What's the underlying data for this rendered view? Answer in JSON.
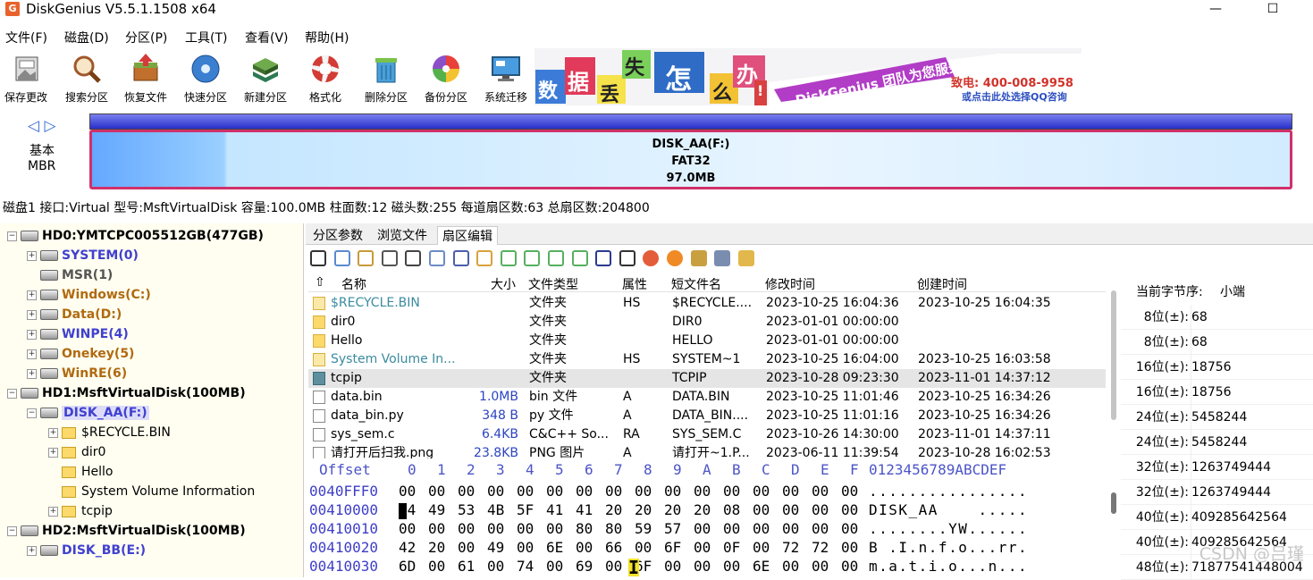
{
  "title": "DiskGenius V5.5.1.1508 x64",
  "app_icon_letter": "G",
  "window_controls": {
    "minimize": "—",
    "maximize": "☐"
  },
  "menu": [
    "文件(F)",
    "磁盘(D)",
    "分区(P)",
    "工具(T)",
    "查看(V)",
    "帮助(H)"
  ],
  "toolbar": [
    {
      "label": "保存更改",
      "icon": "save-icon"
    },
    {
      "label": "搜索分区",
      "icon": "magnifier-icon"
    },
    {
      "label": "恢复文件",
      "icon": "recover-icon"
    },
    {
      "label": "快速分区",
      "icon": "disc-icon"
    },
    {
      "label": "新建分区",
      "icon": "stack-icon"
    },
    {
      "label": "格式化",
      "icon": "lifebuoy-icon"
    },
    {
      "label": "删除分区",
      "icon": "trash-icon"
    },
    {
      "label": "备份分区",
      "icon": "pie-icon"
    },
    {
      "label": "系统迁移",
      "icon": "monitor-icon"
    }
  ],
  "banner": {
    "chars": [
      "数",
      "据",
      "丢",
      "失",
      "怎",
      "么",
      "办",
      "!"
    ],
    "slogan": "DiskGenius 团队为您服务",
    "phone": "致电: 400-008-9958",
    "qq": "或点击此处选择QQ咨询"
  },
  "disk_map": {
    "arrows": "◁ ▷",
    "type_label": "基本",
    "scheme": "MBR",
    "partition_name": "DISK_AA(F:)",
    "partition_fs": "FAT32",
    "partition_size": "97.0MB"
  },
  "disk_info": "磁盘1 接口:Virtual  型号:MsftVirtualDisk  容量:100.0MB  柱面数:12  磁头数:255  每道扇区数:63  总扇区数:204800",
  "tree": [
    {
      "label": "HD0:YMTCPC005512GB(477GB)",
      "level": 0,
      "kind": "disk",
      "color": "black",
      "exp": "−"
    },
    {
      "label": "SYSTEM(0)",
      "level": 1,
      "kind": "part",
      "color": "blue",
      "exp": "+"
    },
    {
      "label": "MSR(1)",
      "level": 1,
      "kind": "part",
      "color": "gray",
      "exp": ""
    },
    {
      "label": "Windows(C:)",
      "level": 1,
      "kind": "part",
      "color": "brown",
      "exp": "+"
    },
    {
      "label": "Data(D:)",
      "level": 1,
      "kind": "part",
      "color": "brown",
      "exp": "+"
    },
    {
      "label": "WINPE(4)",
      "level": 1,
      "kind": "part",
      "color": "blue",
      "exp": "+"
    },
    {
      "label": "Onekey(5)",
      "level": 1,
      "kind": "part",
      "color": "brown",
      "exp": "+"
    },
    {
      "label": "WinRE(6)",
      "level": 1,
      "kind": "part",
      "color": "brown",
      "exp": "+"
    },
    {
      "label": "HD1:MsftVirtualDisk(100MB)",
      "level": 0,
      "kind": "disk",
      "color": "black",
      "exp": "−"
    },
    {
      "label": "DISK_AA(F:)",
      "level": 1,
      "kind": "part",
      "color": "blue",
      "exp": "−",
      "selected": true
    },
    {
      "label": "$RECYCLE.BIN",
      "level": 2,
      "kind": "folder",
      "color": "normal",
      "exp": "+"
    },
    {
      "label": "dir0",
      "level": 2,
      "kind": "folder",
      "color": "normal",
      "exp": "+"
    },
    {
      "label": "Hello",
      "level": 2,
      "kind": "folder",
      "color": "normal",
      "exp": ""
    },
    {
      "label": "System Volume Information",
      "level": 2,
      "kind": "folder",
      "color": "normal",
      "exp": ""
    },
    {
      "label": "tcpip",
      "level": 2,
      "kind": "folder",
      "color": "normal",
      "exp": "+"
    },
    {
      "label": "HD2:MsftVirtualDisk(100MB)",
      "level": 0,
      "kind": "disk",
      "color": "black",
      "exp": "−"
    },
    {
      "label": "DISK_BB(E:)",
      "level": 1,
      "kind": "part",
      "color": "blue",
      "exp": "+"
    }
  ],
  "tabs": [
    "分区参数",
    "浏览文件",
    "扇区编辑"
  ],
  "active_tab": 2,
  "file_table": {
    "up_arrow": "⇧",
    "columns": [
      "名称",
      "大小",
      "文件类型",
      "属性",
      "短文件名",
      "修改时间",
      "创建时间"
    ],
    "rows": [
      {
        "name": "$RECYCLE.BIN",
        "size": "",
        "type": "文件夹",
        "attr": "HS",
        "short": "$RECYCLE....",
        "mtime": "2023-10-25 16:04:36",
        "ctime": "2023-10-25 16:04:35",
        "icon": "folder-icon",
        "hidden": true
      },
      {
        "name": "dir0",
        "size": "",
        "type": "文件夹",
        "attr": "",
        "short": "DIR0",
        "mtime": "2023-01-01 00:00:00",
        "ctime": "",
        "icon": "folder-icon"
      },
      {
        "name": "Hello",
        "size": "",
        "type": "文件夹",
        "attr": "",
        "short": "HELLO",
        "mtime": "2023-01-01 00:00:00",
        "ctime": "",
        "icon": "folder-icon"
      },
      {
        "name": "System Volume In...",
        "size": "",
        "type": "文件夹",
        "attr": "HS",
        "short": "SYSTEM~1",
        "mtime": "2023-10-25 16:04:00",
        "ctime": "2023-10-25 16:03:58",
        "icon": "folder-icon",
        "hidden": true
      },
      {
        "name": "tcpip",
        "size": "",
        "type": "文件夹",
        "attr": "",
        "short": "TCPIP",
        "mtime": "2023-10-28 09:23:30",
        "ctime": "2023-11-01 14:37:12",
        "icon": "folder-icon",
        "selected": true
      },
      {
        "name": "data.bin",
        "size": "1.0MB",
        "type": "bin 文件",
        "attr": "A",
        "short": "DATA.BIN",
        "mtime": "2023-10-25 11:01:46",
        "ctime": "2023-10-25 16:34:26",
        "icon": "file-icon"
      },
      {
        "name": "data_bin.py",
        "size": "348 B",
        "type": "py 文件",
        "attr": "A",
        "short": "DATA_BIN....",
        "mtime": "2023-10-25 11:01:16",
        "ctime": "2023-10-25 16:34:26",
        "icon": "file-icon"
      },
      {
        "name": "sys_sem.c",
        "size": "6.4KB",
        "type": "C&C++ So...",
        "attr": "RA",
        "short": "SYS_SEM.C",
        "mtime": "2023-10-26 14:30:00",
        "ctime": "2023-11-01 14:37:11",
        "icon": "c-file-icon"
      },
      {
        "name": "请打开后扫我.png",
        "size": "23.8KB",
        "type": "PNG 图片",
        "attr": "A",
        "short": "请打开~1.P...",
        "mtime": "2023-06-11 11:39:54",
        "ctime": "2023-10-28 16:02:53",
        "icon": "image-file-icon"
      }
    ]
  },
  "hex": {
    "header_offset": "Offset",
    "header_cols": [
      "0",
      "1",
      "2",
      "3",
      "4",
      "5",
      "6",
      "7",
      "8",
      "9",
      "A",
      "B",
      "C",
      "D",
      "E",
      "F"
    ],
    "header_ascii": "0123456789ABCDEF",
    "rows": [
      {
        "offset": "0040FFF0",
        "bytes": [
          "00",
          "00",
          "00",
          "00",
          "00",
          "00",
          "00",
          "00",
          "00",
          "00",
          "00",
          "00",
          "00",
          "00",
          "00",
          "00"
        ],
        "ascii": "................"
      },
      {
        "offset": "00410000",
        "bytes": [
          "44",
          "49",
          "53",
          "4B",
          "5F",
          "41",
          "41",
          "20",
          "20",
          "20",
          "20",
          "08",
          "00",
          "00",
          "00",
          "00"
        ],
        "ascii": "DISK_AA    ....."
      },
      {
        "offset": "00410010",
        "bytes": [
          "00",
          "00",
          "00",
          "00",
          "00",
          "00",
          "80",
          "80",
          "59",
          "57",
          "00",
          "00",
          "00",
          "00",
          "00",
          "00"
        ],
        "ascii": "........YW......"
      },
      {
        "offset": "00410020",
        "bytes": [
          "42",
          "20",
          "00",
          "49",
          "00",
          "6E",
          "00",
          "66",
          "00",
          "6F",
          "00",
          "0F",
          "00",
          "72",
          "72",
          "00"
        ],
        "ascii": "B .I.n.f.o...rr."
      },
      {
        "offset": "00410030",
        "bytes": [
          "6D",
          "00",
          "61",
          "00",
          "74",
          "00",
          "69",
          "00",
          "6F",
          "00",
          "00",
          "00",
          "6E",
          "00",
          "00",
          "00"
        ],
        "ascii": "m.a.t.i.o...n..."
      }
    ],
    "cursor_char": "4"
  },
  "right_panel": {
    "byte_order_label": "当前字节序:",
    "byte_order": "小端",
    "rows": [
      {
        "label": "8位(±):",
        "value": "68"
      },
      {
        "label": "8位(±):",
        "value": "68"
      },
      {
        "label": "16位(±):",
        "value": "18756"
      },
      {
        "label": "16位(±):",
        "value": "18756"
      },
      {
        "label": "24位(±):",
        "value": "5458244"
      },
      {
        "label": "24位(±):",
        "value": "5458244"
      },
      {
        "label": "32位(±):",
        "value": "1263749444"
      },
      {
        "label": "32位(±):",
        "value": "1263749444"
      },
      {
        "label": "40位(±):",
        "value": "409285642564"
      },
      {
        "label": "40位(±):",
        "value": "409285642564"
      },
      {
        "label": "48位(±):",
        "value": "71877541448004"
      }
    ]
  },
  "watermark": "CSDN @吕瑾"
}
